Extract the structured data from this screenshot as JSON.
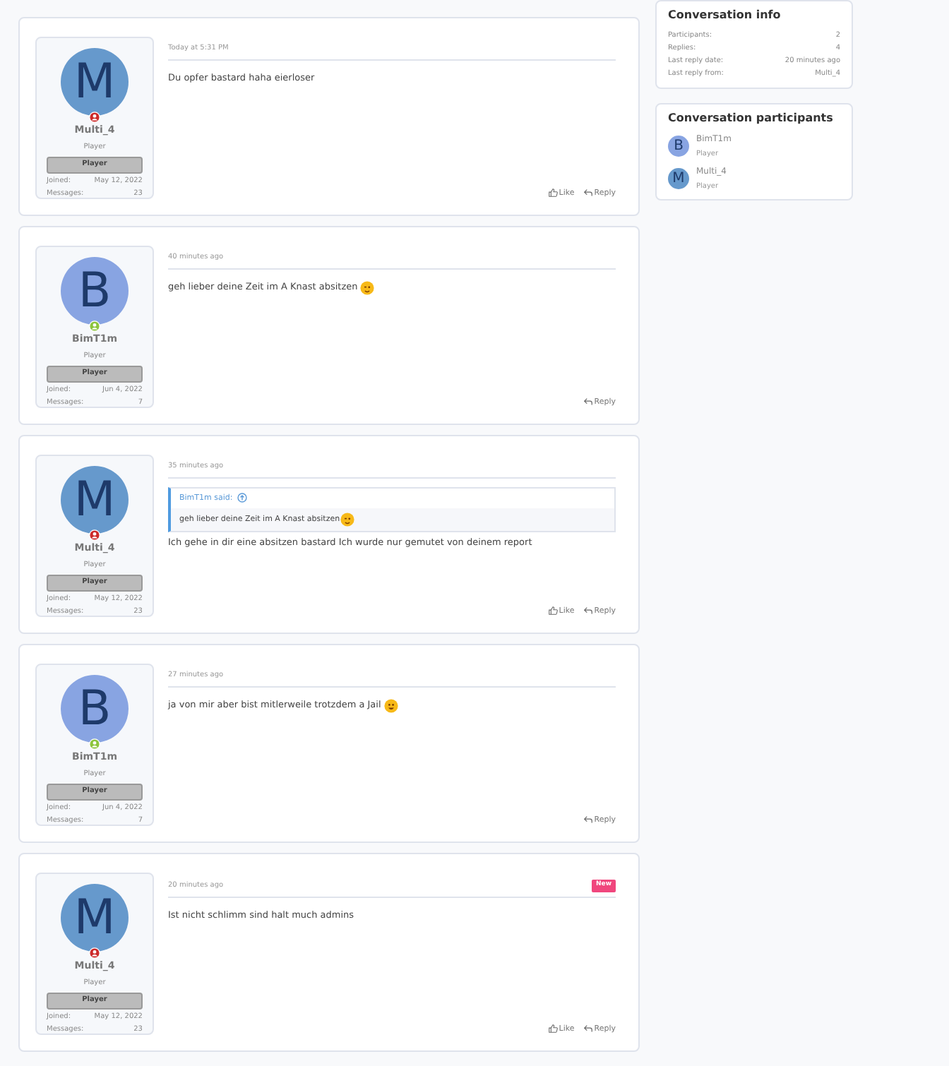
{
  "posts": [
    {
      "kind": "plain",
      "avatar_letter": "M",
      "color": "#6699cc",
      "online": false,
      "author": "Multi_4",
      "user_title": "Player",
      "banner": "Player",
      "joined_label": "Joined:",
      "joined": "May 12, 2022",
      "messages_label": "Messages:",
      "messages": "23",
      "time": "Today at 5:31 PM",
      "body": "Du opfer bastard haha eierloser",
      "actions": [
        "Like",
        "Reply"
      ]
    },
    {
      "kind": "wink",
      "avatar_letter": "B",
      "color": "#88a4e2",
      "online": true,
      "author": "BimT1m",
      "user_title": "Player",
      "banner": "Player",
      "joined_label": "Joined:",
      "joined": "Jun 4, 2022",
      "messages_label": "Messages:",
      "messages": "7",
      "time": "40 minutes ago",
      "body": "geh lieber deine Zeit im A Knast absitzen",
      "actions": [
        "Reply"
      ]
    },
    {
      "kind": "plain",
      "avatar_letter": "M",
      "color": "#6699cc",
      "online": false,
      "author": "Multi_4",
      "user_title": "Player",
      "banner": "Player",
      "joined_label": "Joined:",
      "joined": "May 12, 2022",
      "messages_label": "Messages:",
      "messages": "23",
      "time": "35 minutes ago",
      "quote": {
        "kind": "wink",
        "attribution": "BimT1m said:",
        "text": "geh lieber deine Zeit im A Knast absitzen"
      },
      "body": "Ich gehe in dir eine absitzen bastard Ich wurde nur gemutet von deinem report",
      "actions": [
        "Like",
        "Reply"
      ]
    },
    {
      "kind": "smile",
      "avatar_letter": "B",
      "color": "#88a4e2",
      "online": true,
      "author": "BimT1m",
      "user_title": "Player",
      "banner": "Player",
      "joined_label": "Joined:",
      "joined": "Jun 4, 2022",
      "messages_label": "Messages:",
      "messages": "7",
      "time": "27 minutes ago",
      "body": "ja von mir aber bist mitlerweile trotzdem a Jail",
      "actions": [
        "Reply"
      ]
    },
    {
      "kind": "plain",
      "avatar_letter": "M",
      "color": "#6699cc",
      "online": false,
      "author": "Multi_4",
      "user_title": "Player",
      "banner": "Player",
      "joined_label": "Joined:",
      "joined": "May 12, 2022",
      "messages_label": "Messages:",
      "messages": "23",
      "time": "20 minutes ago",
      "new_badge": "New",
      "body": "Ist nicht schlimm sind halt much admins",
      "actions": [
        "Like",
        "Reply"
      ]
    }
  ],
  "conversation_info": {
    "title": "Conversation info",
    "rows": [
      {
        "label": "Participants:",
        "value": "2"
      },
      {
        "label": "Replies:",
        "value": "4"
      },
      {
        "label": "Last reply date:",
        "value": "20 minutes ago"
      },
      {
        "label": "Last reply from:",
        "value": "Multi_4"
      }
    ]
  },
  "participants": {
    "title": "Conversation participants",
    "items": [
      {
        "avatar_letter": "B",
        "color": "#88a4e2",
        "name": "BimT1m",
        "user_title": "Player"
      },
      {
        "avatar_letter": "M",
        "color": "#6699cc",
        "name": "Multi_4",
        "user_title": "Player"
      }
    ]
  }
}
